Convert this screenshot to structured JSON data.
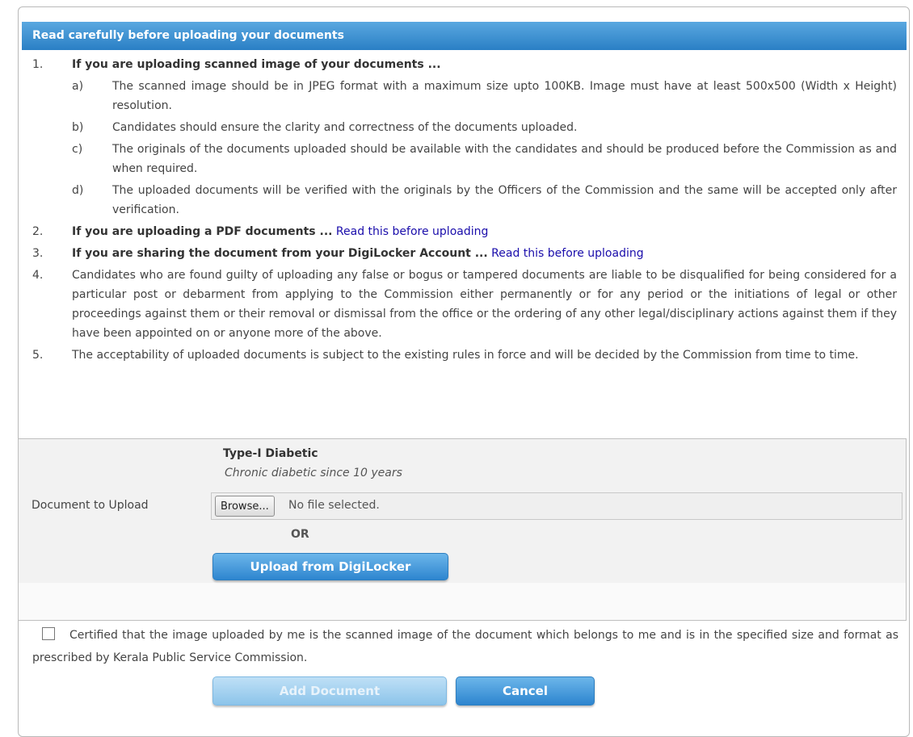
{
  "header": {
    "title": "Read carefully before uploading your documents"
  },
  "instructions": {
    "item1": {
      "num": "1.",
      "text": "If you are uploading scanned image of your documents ...",
      "subs": [
        {
          "letter": "a)",
          "text": "The scanned image should be in JPEG format with a maximum size upto 100KB. Image must have at least 500x500 (Width x Height) resolution."
        },
        {
          "letter": "b)",
          "text": "Candidates should ensure the clarity and correctness of the documents uploaded."
        },
        {
          "letter": "c)",
          "text": "The originals of the documents uploaded should be available with the candidates and should be produced before the Commission as and when required."
        },
        {
          "letter": "d)",
          "text": "The uploaded documents will be verified with the originals by the Officers of the Commission and the same will be accepted only after verification."
        }
      ]
    },
    "item2": {
      "num": "2.",
      "text": "If you are uploading a PDF documents ...",
      "link": "Read this before uploading"
    },
    "item3": {
      "num": "3.",
      "text": "If you are sharing the document from your DigiLocker Account ...",
      "link": "Read this before uploading"
    },
    "item4": {
      "num": "4.",
      "text": "Candidates who are found guilty of uploading any false or bogus or tampered documents are liable to be disqualified for being considered for a particular post or debarment from applying to the Commission either permanently or for any period or the initiations of legal or other proceedings against them or their removal or dismissal from the office or the ordering of any other legal/disciplinary actions against them if they have been appointed on or anyone more of the above."
    },
    "item5": {
      "num": "5.",
      "text": "The acceptability of uploaded documents is subject to the existing rules in force and will be decided by the Commission from time to time."
    }
  },
  "upload": {
    "doc_title": "Type-I Diabetic",
    "doc_subtitle": "Chronic diabetic since 10 years",
    "label": "Document to Upload",
    "browse_label": "Browse...",
    "file_status": "No file selected.",
    "or_text": "OR",
    "digilocker_button": "Upload from DigiLocker"
  },
  "certification": {
    "checked": false,
    "text": "Certified that the image uploaded by me is the scanned image of the document which belongs to me and is in the specified size and format as prescribed by Kerala Public Service Commission."
  },
  "actions": {
    "add_label": "Add Document",
    "cancel_label": "Cancel"
  }
}
